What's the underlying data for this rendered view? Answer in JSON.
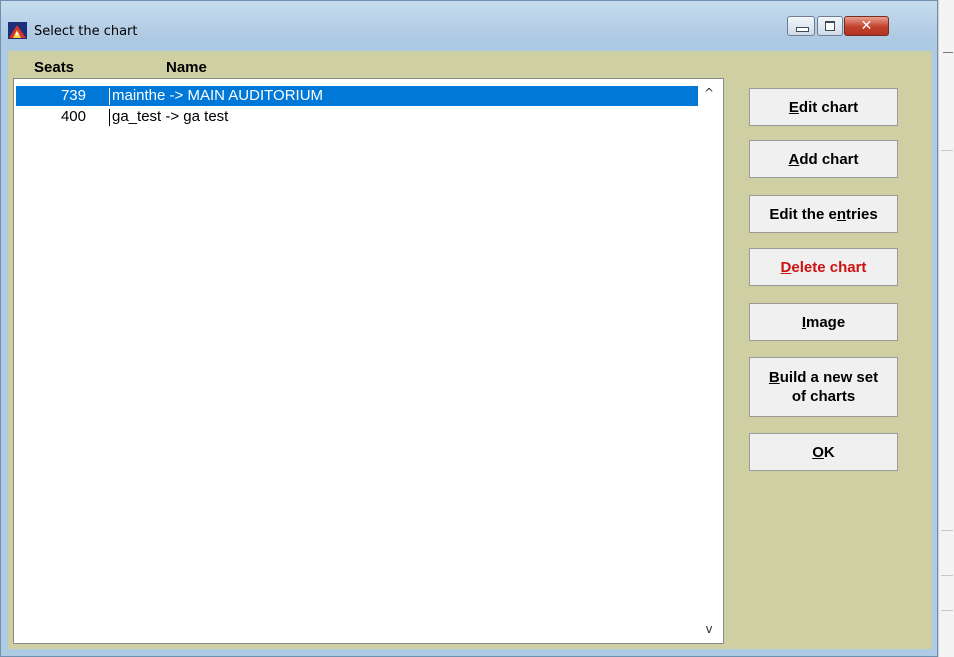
{
  "window": {
    "title": "Select the chart",
    "minimize_glyph": "—",
    "maximize_glyph": "□",
    "close_glyph": "✕"
  },
  "list": {
    "columns": {
      "seats": "Seats",
      "name": "Name"
    },
    "rows": [
      {
        "seats": "739",
        "name": "mainthe -> MAIN AUDITORIUM",
        "selected": true
      },
      {
        "seats": "400",
        "name": "ga_test -> ga test",
        "selected": false
      }
    ],
    "scroll_up": "^",
    "scroll_down": "v"
  },
  "buttons": {
    "edit_chart": {
      "prefix": "",
      "mnemonic": "E",
      "suffix": "dit chart"
    },
    "add_chart": {
      "prefix": "",
      "mnemonic": "A",
      "suffix": "dd chart"
    },
    "edit_entries": {
      "prefix": "Edit the e",
      "mnemonic": "n",
      "suffix": "tries"
    },
    "delete_chart": {
      "prefix": "",
      "mnemonic": "D",
      "suffix": "elete chart"
    },
    "image": {
      "prefix": "",
      "mnemonic": "I",
      "suffix": "mage"
    },
    "build_set_line1": {
      "prefix": "",
      "mnemonic": "B",
      "suffix": "uild a new set"
    },
    "build_set_line2": "of charts",
    "ok": {
      "prefix": "",
      "mnemonic": "O",
      "suffix": "K"
    }
  },
  "colors": {
    "client_bg": "#cfcfa4",
    "selection": "#0078d7",
    "delete_text": "#cc1111"
  }
}
